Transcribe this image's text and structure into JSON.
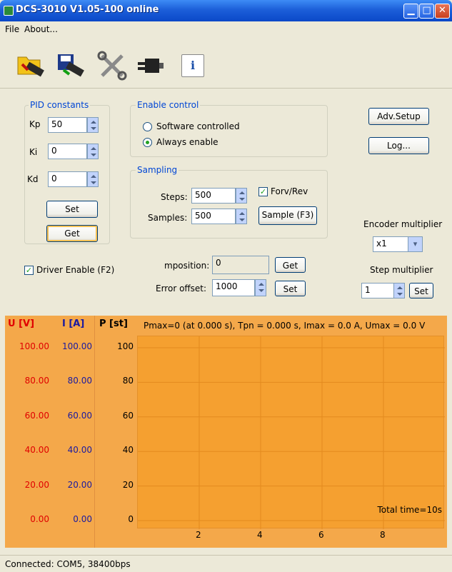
{
  "window": {
    "title": "DCS-3010 V1.05-100 online"
  },
  "menu": {
    "file": "File",
    "about": "About..."
  },
  "toolbar": {
    "info_glyph": "i",
    "icons": [
      "open-chip-icon",
      "save-chip-icon",
      "tools-icon",
      "serial-connector-icon",
      "info-icon"
    ]
  },
  "pid": {
    "group_label": "PID constants",
    "kp_label": "Kp",
    "kp_value": "50",
    "ki_label": "Ki",
    "ki_value": "0",
    "kd_label": "Kd",
    "kd_value": "0",
    "set_label": "Set",
    "get_label": "Get"
  },
  "enable_control": {
    "group_label": "Enable control",
    "option_software": "Software controlled",
    "option_always": "Always enable",
    "selected": "Always enable"
  },
  "sampling": {
    "group_label": "Sampling",
    "steps_label": "Steps:",
    "steps_value": "500",
    "samples_label": "Samples:",
    "samples_value": "500",
    "forv_rev_label": "Forv/Rev",
    "forv_rev_checked": true,
    "sample_button": "Sample (F3)"
  },
  "right": {
    "adv_setup": "Adv.Setup",
    "log": "Log...",
    "encoder_label": "Encoder multiplier",
    "encoder_value": "x1",
    "step_label": "Step multiplier",
    "step_value": "1",
    "step_set": "Set"
  },
  "driver": {
    "enable_label": "Driver Enable (F2)",
    "checked": true
  },
  "position": {
    "mposition_label": "mposition:",
    "mposition_value": "0",
    "get_label": "Get",
    "error_offset_label": "Error offset:",
    "error_offset_value": "1000",
    "set_label": "Set"
  },
  "chart_header": {
    "u_label": "U [V]",
    "i_label": "I [A]",
    "p_label": "P [st]",
    "summary": "Pmax=0 (at  0.000 s), Tpn = 0.000  s, Imax =  0.0 A, Umax = 0.0  V",
    "total_time": "Total time=10s"
  },
  "chart_data": {
    "type": "line",
    "u_axis": {
      "label": "U [V]",
      "ticks": [
        "100.00",
        "80.00",
        "60.00",
        "40.00",
        "20.00",
        "0.00"
      ],
      "range": [
        0,
        100
      ],
      "color": "#e00000"
    },
    "i_axis": {
      "label": "I [A]",
      "ticks": [
        "100.00",
        "80.00",
        "60.00",
        "40.00",
        "20.00",
        "0.00"
      ],
      "range": [
        0,
        100
      ],
      "color": "#1a1aa0"
    },
    "p_axis": {
      "label": "P [st]",
      "ticks": [
        "100",
        "80",
        "60",
        "40",
        "20",
        "0"
      ],
      "range": [
        0,
        100
      ],
      "color": "#000000"
    },
    "x_ticks": [
      "2",
      "4",
      "6",
      "8"
    ],
    "x_range": [
      0,
      10
    ],
    "series": [],
    "grid": true,
    "annotation": "Total time=10s"
  },
  "status": {
    "text": "Connected: COM5, 38400bps"
  }
}
